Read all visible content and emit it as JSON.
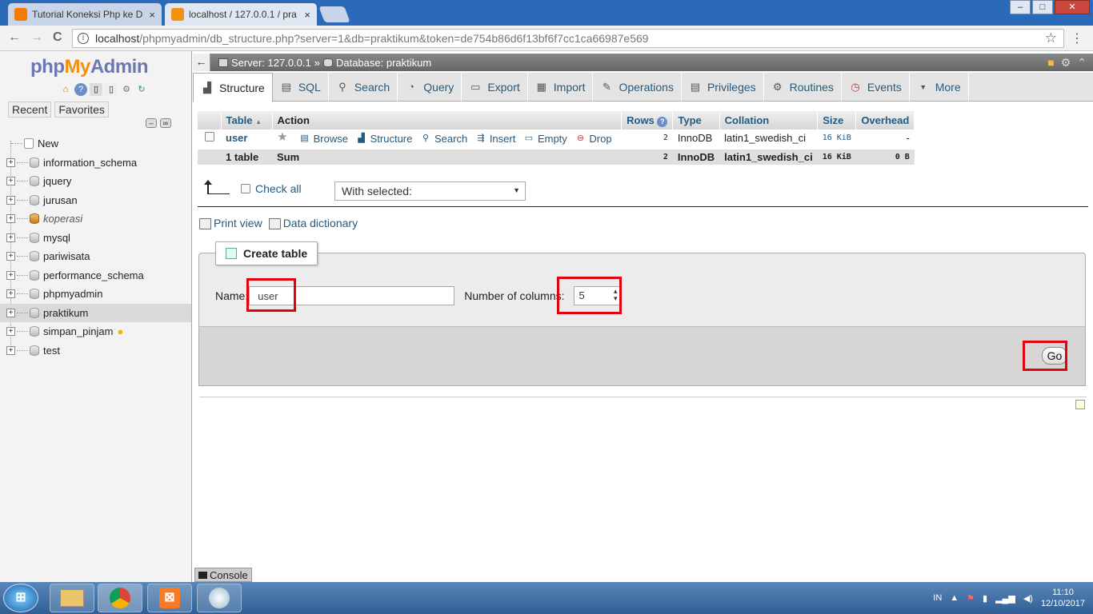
{
  "browser": {
    "tabs": [
      {
        "title": "Tutorial Koneksi Php ke D",
        "close": "×"
      },
      {
        "title": "localhost / 127.0.0.1 / pra",
        "close": "×"
      }
    ],
    "window_controls": [
      "–",
      "□",
      "✕"
    ],
    "url_host": "localhost",
    "url_path": "/phpmyadmin/db_structure.php?server=1&db=praktikum&token=de754b86d6f13bf6f7cc1ca66987e569",
    "nav": {
      "back": "←",
      "forward": "→",
      "reload": "C",
      "star": "☆",
      "menu": "⋮",
      "info": "i"
    }
  },
  "left": {
    "logo": {
      "php": "php",
      "my": "My",
      "admin": "Admin"
    },
    "recent_label": "Recent",
    "favorites_label": "Favorites",
    "new_label": "New",
    "databases": [
      {
        "name": "information_schema",
        "style": "normal"
      },
      {
        "name": "jquery",
        "style": "normal"
      },
      {
        "name": "jurusan",
        "style": "normal"
      },
      {
        "name": "koperasi",
        "style": "italic"
      },
      {
        "name": "mysql",
        "style": "normal"
      },
      {
        "name": "pariwisata",
        "style": "normal"
      },
      {
        "name": "performance_schema",
        "style": "normal"
      },
      {
        "name": "phpmyadmin",
        "style": "normal"
      },
      {
        "name": "praktikum",
        "style": "selected"
      },
      {
        "name": "simpan_pinjam",
        "style": "bulb"
      },
      {
        "name": "test",
        "style": "normal"
      }
    ]
  },
  "breadcrumb": {
    "back": "←",
    "server": "Server: 127.0.0.1",
    "sep": "»",
    "database": "Database: praktikum"
  },
  "tabs": [
    {
      "label": "Structure",
      "icon": "▟"
    },
    {
      "label": "SQL",
      "icon": "▤"
    },
    {
      "label": "Search",
      "icon": "⚲"
    },
    {
      "label": "Query",
      "icon": "◔"
    },
    {
      "label": "Export",
      "icon": "▭"
    },
    {
      "label": "Import",
      "icon": "▦"
    },
    {
      "label": "Operations",
      "icon": "✎"
    },
    {
      "label": "Privileges",
      "icon": "▤"
    },
    {
      "label": "Routines",
      "icon": "⚙"
    },
    {
      "label": "Events",
      "icon": "◷"
    },
    {
      "label": "More",
      "icon": "▼"
    }
  ],
  "table": {
    "headers": [
      "Table",
      "Action",
      "Rows",
      "Type",
      "Collation",
      "Size",
      "Overhead"
    ],
    "sort_arrow": "▲",
    "help_icon": "?",
    "rows": [
      {
        "name": "user",
        "actions": [
          "Browse",
          "Structure",
          "Search",
          "Insert",
          "Empty",
          "Drop"
        ],
        "rows": "2",
        "type": "InnoDB",
        "collation": "latin1_swedish_ci",
        "size": "16 KiB",
        "overhead": "-"
      }
    ],
    "sum": {
      "label": "1 table",
      "sum": "Sum",
      "rows": "2",
      "type": "InnoDB",
      "collation": "latin1_swedish_ci",
      "size": "16 KiB",
      "overhead": "0 B"
    }
  },
  "bulk": {
    "check_all": "Check all",
    "with_selected": "With selected:"
  },
  "links": {
    "print_view": "Print view",
    "data_dictionary": "Data dictionary"
  },
  "create": {
    "legend": "Create table",
    "name_label": "Name:",
    "name_value": "user",
    "columns_label": "Number of columns:",
    "columns_value": "5",
    "go": "Go"
  },
  "console_label": "Console",
  "taskbar": {
    "lang": "IN",
    "time": "11:10",
    "date": "12/10/2017"
  }
}
